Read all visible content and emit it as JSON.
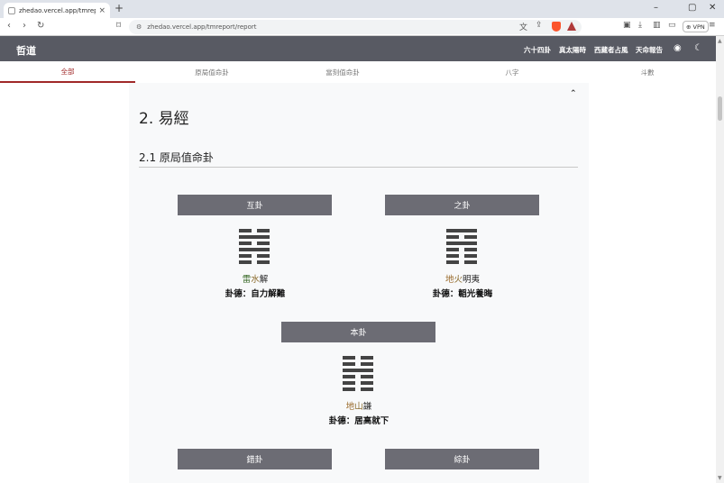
{
  "browser": {
    "tab_title": "zhedao.vercel.app/tmreport/rep",
    "url": "zhedao.vercel.app/tmreport/report",
    "vpn_label": "VPN"
  },
  "navbar": {
    "brand": "哲道",
    "links": [
      "六十四卦",
      "真太陽時",
      "西藏者占風",
      "天命報告"
    ]
  },
  "tabs": [
    "全部",
    "原局值命卦",
    "當刻值命卦",
    "八字",
    "斗數"
  ],
  "active_tab": 0,
  "section": {
    "title": "2. 易經",
    "subtitle": "2.1 原局值命卦"
  },
  "guas": {
    "hugua": {
      "label": "互卦",
      "lines": [
        0,
        1,
        0,
        1,
        0,
        0
      ],
      "name_a": "雷",
      "name_b": "水",
      "name_c": "解",
      "de": "卦德：自力解難"
    },
    "zhigua": {
      "label": "之卦",
      "lines": [
        1,
        0,
        1,
        0,
        0,
        0
      ],
      "name_a": "地",
      "name_b": "火",
      "name_c": "明夷",
      "de": "卦德：韜光養晦"
    },
    "bengua": {
      "label": "本卦",
      "lines": [
        0,
        0,
        1,
        0,
        0,
        0
      ],
      "name_a": "地",
      "name_b": "山",
      "name_c": "謙",
      "de": "卦德：居高就下"
    }
  },
  "bottom_buttons": [
    "錯卦",
    "綜卦"
  ],
  "icons": [
    "palette-icon",
    "moon-icon",
    "chevrons-up-icon"
  ]
}
